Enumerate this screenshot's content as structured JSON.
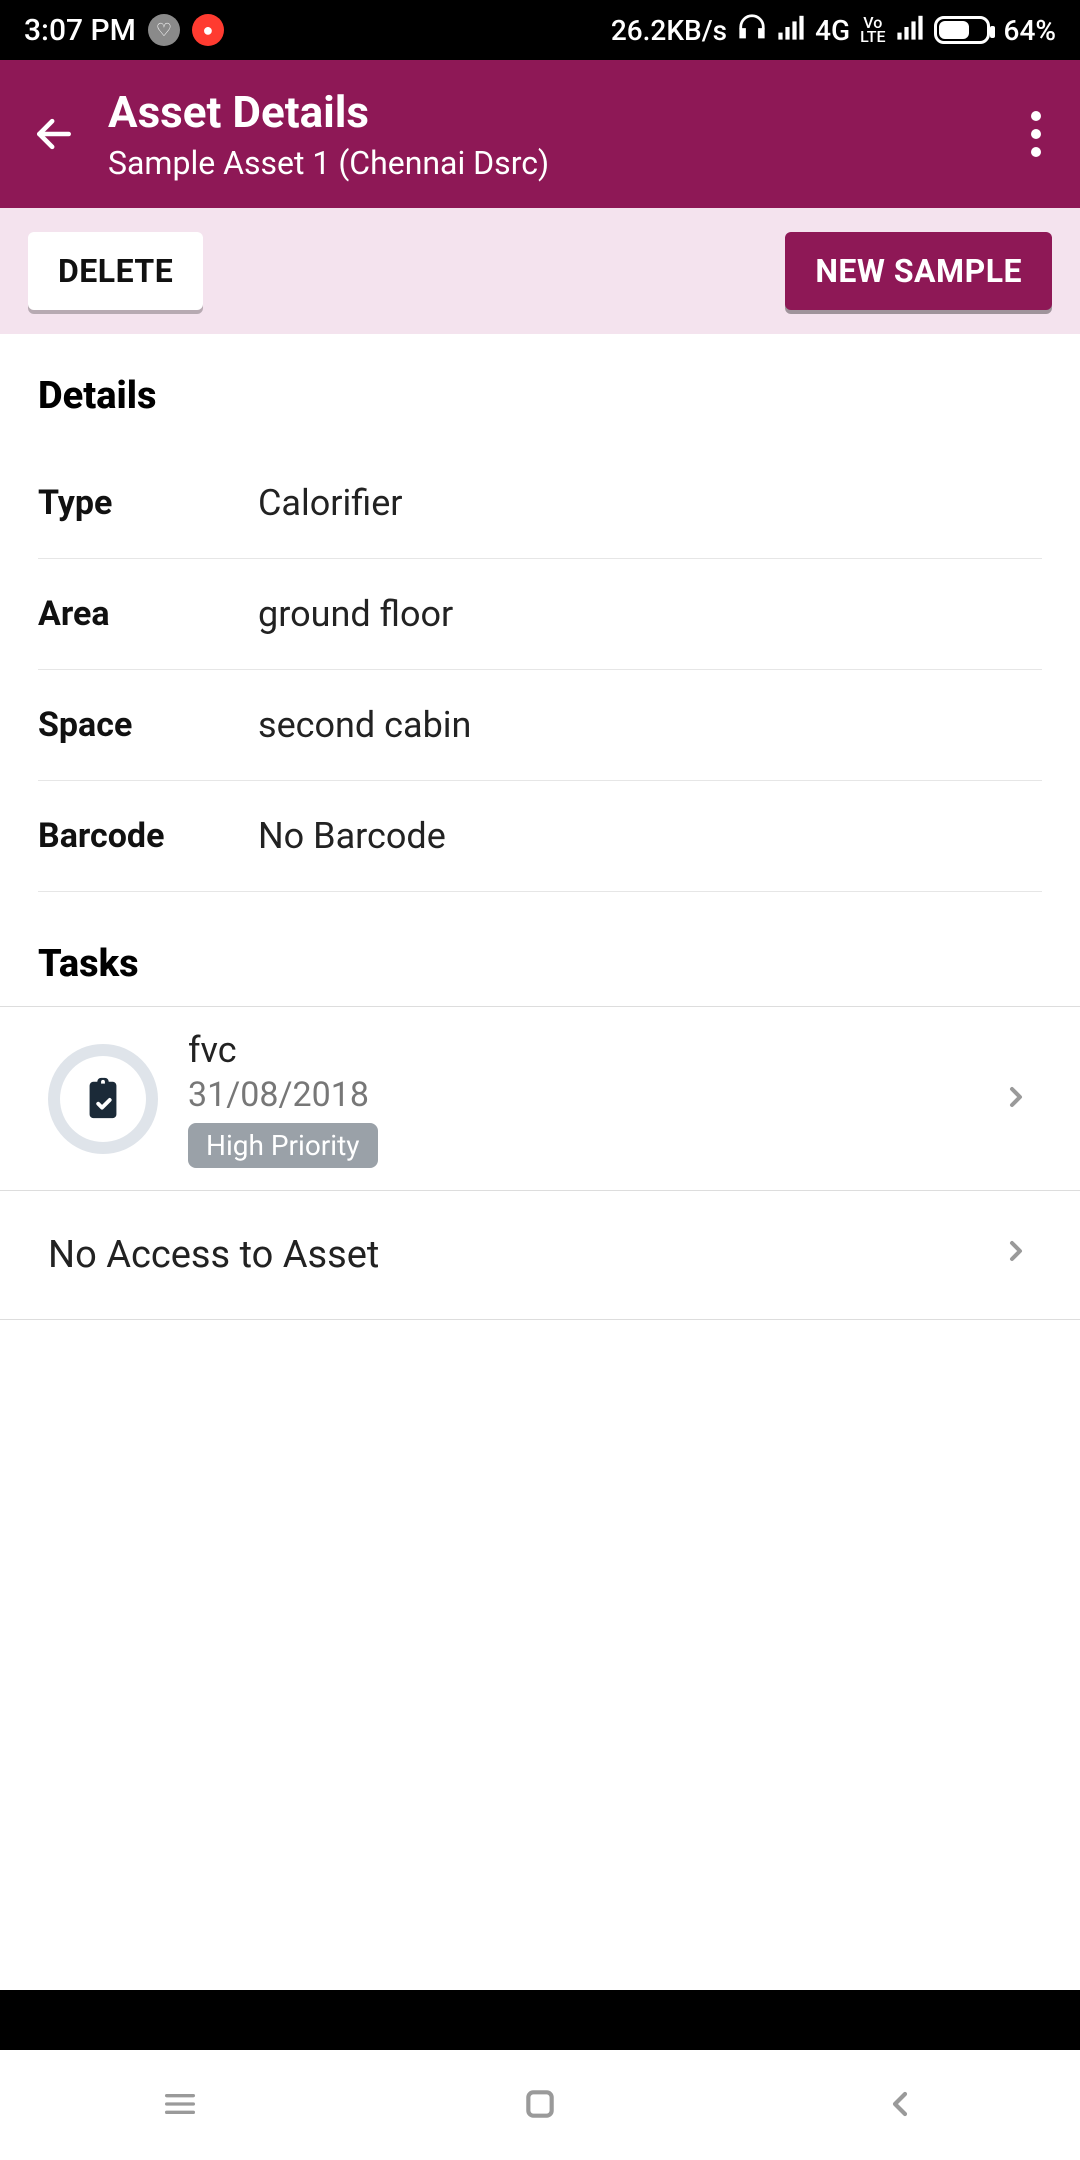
{
  "status": {
    "time": "3:07 PM",
    "net_speed": "26.2KB/s",
    "net_type": "4G",
    "volte": "Vo LTE",
    "battery_pct": "64%"
  },
  "header": {
    "title": "Asset Details",
    "subtitle": "Sample Asset 1 (Chennai Dsrc)"
  },
  "actions": {
    "delete_label": "DELETE",
    "new_sample_label": "NEW SAMPLE"
  },
  "details": {
    "section_title": "Details",
    "rows": [
      {
        "label": "Type",
        "value": "Calorifier"
      },
      {
        "label": "Area",
        "value": "ground floor"
      },
      {
        "label": "Space",
        "value": "second cabin"
      },
      {
        "label": "Barcode",
        "value": "No Barcode"
      }
    ]
  },
  "tasks": {
    "section_title": "Tasks",
    "items": [
      {
        "name": "fvc",
        "date": "31/08/2018",
        "priority": "High Priority"
      }
    ],
    "no_access_label": "No Access to Asset"
  }
}
